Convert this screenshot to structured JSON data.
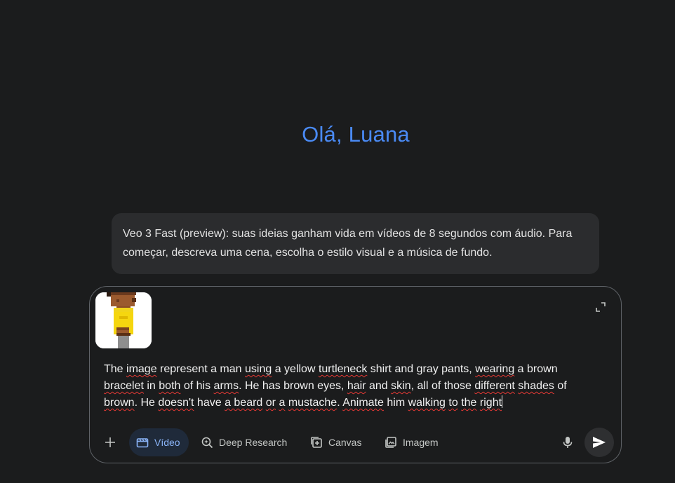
{
  "greeting": "Olá, Luana",
  "info_card": {
    "text": "Veo 3 Fast (preview): suas ideias ganham vida em vídeos de 8 segundos com áudio. Para começar, descreva uma cena, escolha o estilo visual e a música de fundo."
  },
  "composer": {
    "attachment": {
      "kind": "pixel-art image of a character in yellow shirt"
    },
    "prompt_parts": [
      "The ",
      "image",
      " represent a man ",
      "using",
      " a yellow ",
      "turtleneck",
      " shirt and gray pants, ",
      "wearing",
      " a brown",
      "bracelet",
      " in ",
      "both",
      " of his ",
      "arms",
      ". He has brown eyes, ",
      "hair",
      " and ",
      "skin",
      ", all of those ",
      "different",
      " ",
      "shades",
      " of",
      "brown",
      ". He ",
      "doesn't",
      " have ",
      "a beard",
      " ",
      "or",
      " ",
      "a",
      " ",
      "mustache",
      ". ",
      "Animate",
      " him ",
      "walking",
      " ",
      "to",
      " ",
      "the",
      " ",
      "right"
    ],
    "prompt_line1": "The image represent a man using a yellow turtleneck shirt and gray pants, wearing a brown",
    "prompt_line2": "bracelet in both of his arms. He has brown eyes, hair and skin, all of those different shades of",
    "prompt_line3": "brown. He doesn't have a beard or a mustache. Animate him walking to the right"
  },
  "toolbar": {
    "add_icon": "plus-icon",
    "video_label": "Vídeo",
    "video_icon": "clapperboard-icon",
    "deep_research_label": "Deep Research",
    "deep_research_icon": "search-sparkle-icon",
    "canvas_label": "Canvas",
    "canvas_icon": "canvas-icon",
    "image_label": "Imagem",
    "image_icon": "image-gallery-icon",
    "mic_icon": "microphone-icon",
    "send_icon": "send-icon"
  },
  "colors": {
    "background": "#1b1c1d",
    "accent": "#4a8af4",
    "video_chip_bg": "#1f2a3a",
    "video_chip_text": "#8ab4f8",
    "spellcheck": "#e53935"
  }
}
